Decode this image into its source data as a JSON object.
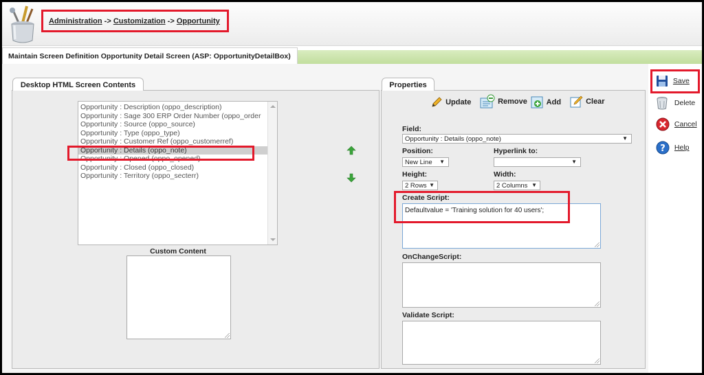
{
  "breadcrumb": {
    "items": [
      "Administration",
      "Customization",
      "Opportunity"
    ],
    "separator": " -> "
  },
  "screen_title": "Maintain Screen Definition Opportunity Detail Screen (ASP: OpportunityDetailBox)",
  "left_panel": {
    "tab_label": "Desktop HTML Screen Contents",
    "fields": [
      "Opportunity : Description (oppo_description)",
      "Opportunity : Sage 300 ERP Order Number (oppo_order",
      "Opportunity : Source (oppo_source)",
      "Opportunity : Type (oppo_type)",
      "Opportunity : Customer Ref (oppo_customerref)",
      "Opportunity : Details (oppo_note)",
      "Opportunity : Opened (oppo_opened)",
      "Opportunity : Closed (oppo_closed)",
      "Opportunity : Territory (oppo_secterr)"
    ],
    "selected_index": 5,
    "custom_content_label": "Custom Content"
  },
  "properties": {
    "tab_label": "Properties",
    "toolbar": {
      "update": "Update",
      "remove": "Remove",
      "add": "Add",
      "clear": "Clear"
    },
    "field_label": "Field:",
    "field_value": "Opportunity : Details (oppo_note)",
    "position_label": "Position:",
    "position_value": "New Line",
    "hyperlink_label": "Hyperlink to:",
    "hyperlink_value": "",
    "height_label": "Height:",
    "height_value": "2 Rows",
    "width_label": "Width:",
    "width_value": "2 Columns",
    "create_script_label": "Create Script:",
    "create_script_value": "Defaultvalue = 'Training solution for 40 users';",
    "onchange_label": "OnChangeScript:",
    "onchange_value": "",
    "validate_label": "Validate Script:",
    "validate_value": ""
  },
  "actions": {
    "save": "Save",
    "delete": "Delete",
    "cancel": "Cancel",
    "help": "Help"
  },
  "colors": {
    "highlight": "#e3192b",
    "green_band": "#c1de9d",
    "save_blue": "#1f4f9c",
    "cancel_red": "#d8262e",
    "help_blue": "#2a6fc9"
  }
}
